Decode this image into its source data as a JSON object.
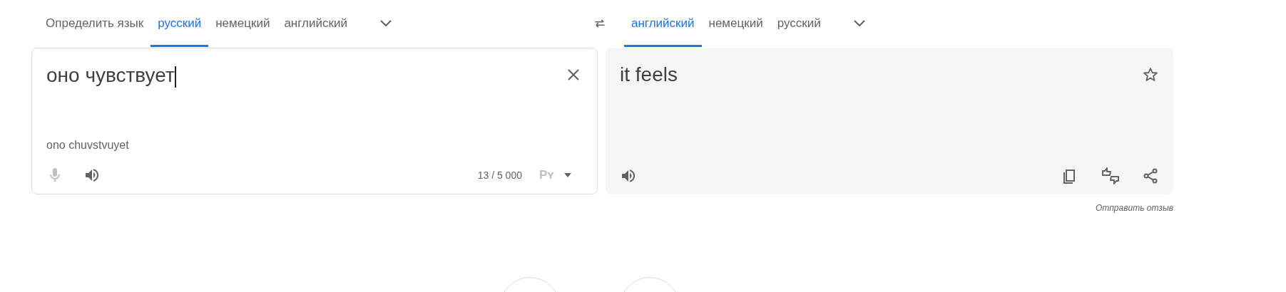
{
  "source_tabs": [
    {
      "label": "Определить язык",
      "selected": false
    },
    {
      "label": "русский",
      "selected": true
    },
    {
      "label": "немецкий",
      "selected": false
    },
    {
      "label": "английский",
      "selected": false
    }
  ],
  "target_tabs": [
    {
      "label": "английский",
      "selected": true
    },
    {
      "label": "немецкий",
      "selected": false
    },
    {
      "label": "русский",
      "selected": false
    }
  ],
  "source": {
    "text": "оно чувствует",
    "transliteration": "ono chuvstvuyet",
    "char_count": "13 / 5 000",
    "input_tool": "Pʏ",
    "mic_disabled": true
  },
  "target": {
    "text": "it feels"
  },
  "feedback_link": "Отправить отзыв"
}
